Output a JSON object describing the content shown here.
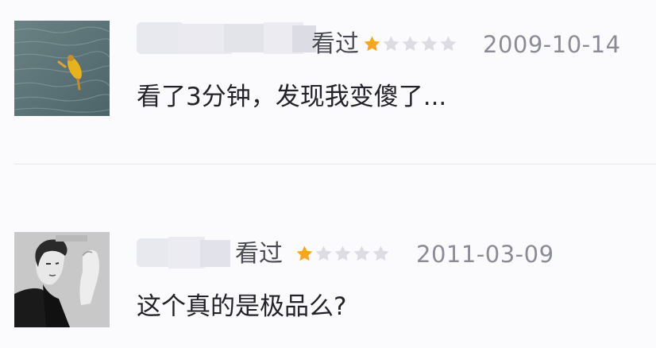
{
  "reviews": [
    {
      "avatar": "avatar-swimmer-in-water",
      "status": "看过",
      "rating": 1,
      "max_rating": 5,
      "date": "2009-10-14",
      "comment": "看了3分钟，发现我变傻了..."
    },
    {
      "avatar": "avatar-bw-portrait",
      "status": "看过",
      "rating": 1,
      "max_rating": 5,
      "date": "2011-03-09",
      "comment": "这个真的是极品么?"
    }
  ],
  "colors": {
    "star_filled": "#f5a623",
    "star_empty": "#dcdce2",
    "date": "#8c8c96",
    "status": "#4a4a52",
    "comment": "#222228"
  }
}
